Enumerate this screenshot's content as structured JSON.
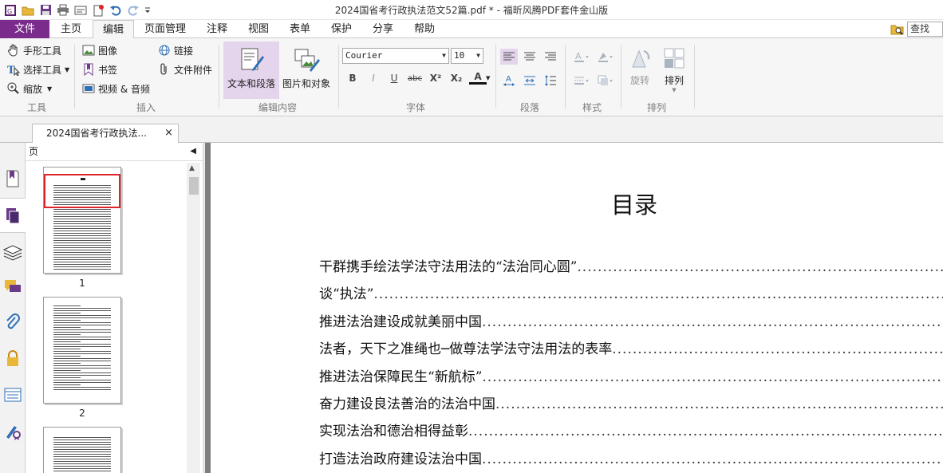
{
  "window": {
    "title": "2024国省考行政执法范文52篇.pdf * - 福昕风腾PDF套件金山版"
  },
  "quick_access": [
    "app-logo-icon",
    "open-icon",
    "save-icon",
    "print-icon",
    "scan-icon",
    "new-icon",
    "undo-icon",
    "redo-icon",
    "customize-icon"
  ],
  "menu": {
    "tabs": [
      "文件",
      "主页",
      "编辑",
      "页面管理",
      "注释",
      "视图",
      "表单",
      "保护",
      "分享",
      "帮助"
    ],
    "active": "编辑",
    "search_placeholder": "查找"
  },
  "ribbon": {
    "tools": {
      "hand": "手形工具",
      "select": "选择工具",
      "zoom": "缩放",
      "label": "工具"
    },
    "insert": {
      "image": "图像",
      "bookmark": "书签",
      "video": "视频 & 音频",
      "link": "链接",
      "attachment": "文件附件",
      "label": "插入"
    },
    "edit_content": {
      "text": "文本和段落",
      "image": "图片和对象",
      "label": "编辑内容"
    },
    "font": {
      "family": "Courier",
      "size": "10",
      "label": "字体",
      "buttons": [
        "B",
        "I",
        "U",
        "abc",
        "X²",
        "X₂",
        "A"
      ]
    },
    "paragraph": {
      "label": "段落"
    },
    "style": {
      "label": "样式"
    },
    "arrange": {
      "rotate": "旋转",
      "arrange": "排列",
      "label": "排列"
    }
  },
  "document_tab": {
    "label": "2024国省考行政执法...",
    "close": "×"
  },
  "page_panel": {
    "title": "页",
    "collapse": "◀",
    "pages": [
      "1",
      "2"
    ]
  },
  "document": {
    "title": "目录",
    "toc": [
      "干群携手绘法学法守法用法的“法治同心圆”",
      "谈“执法”",
      "推进法治建设成就美丽中国",
      "法者，天下之准绳也─做尊法学法守法用法的表率",
      "推进法治保障民生“新航标”",
      "奋力建设良法善治的法治中国",
      "实现法治和德治相得益彰",
      "打造法治政府建设法治中国"
    ]
  },
  "colors": {
    "file_tab": "#7a2b8c",
    "selected_button": "#e4d4ec",
    "thumb_highlight": "#e0242b"
  }
}
